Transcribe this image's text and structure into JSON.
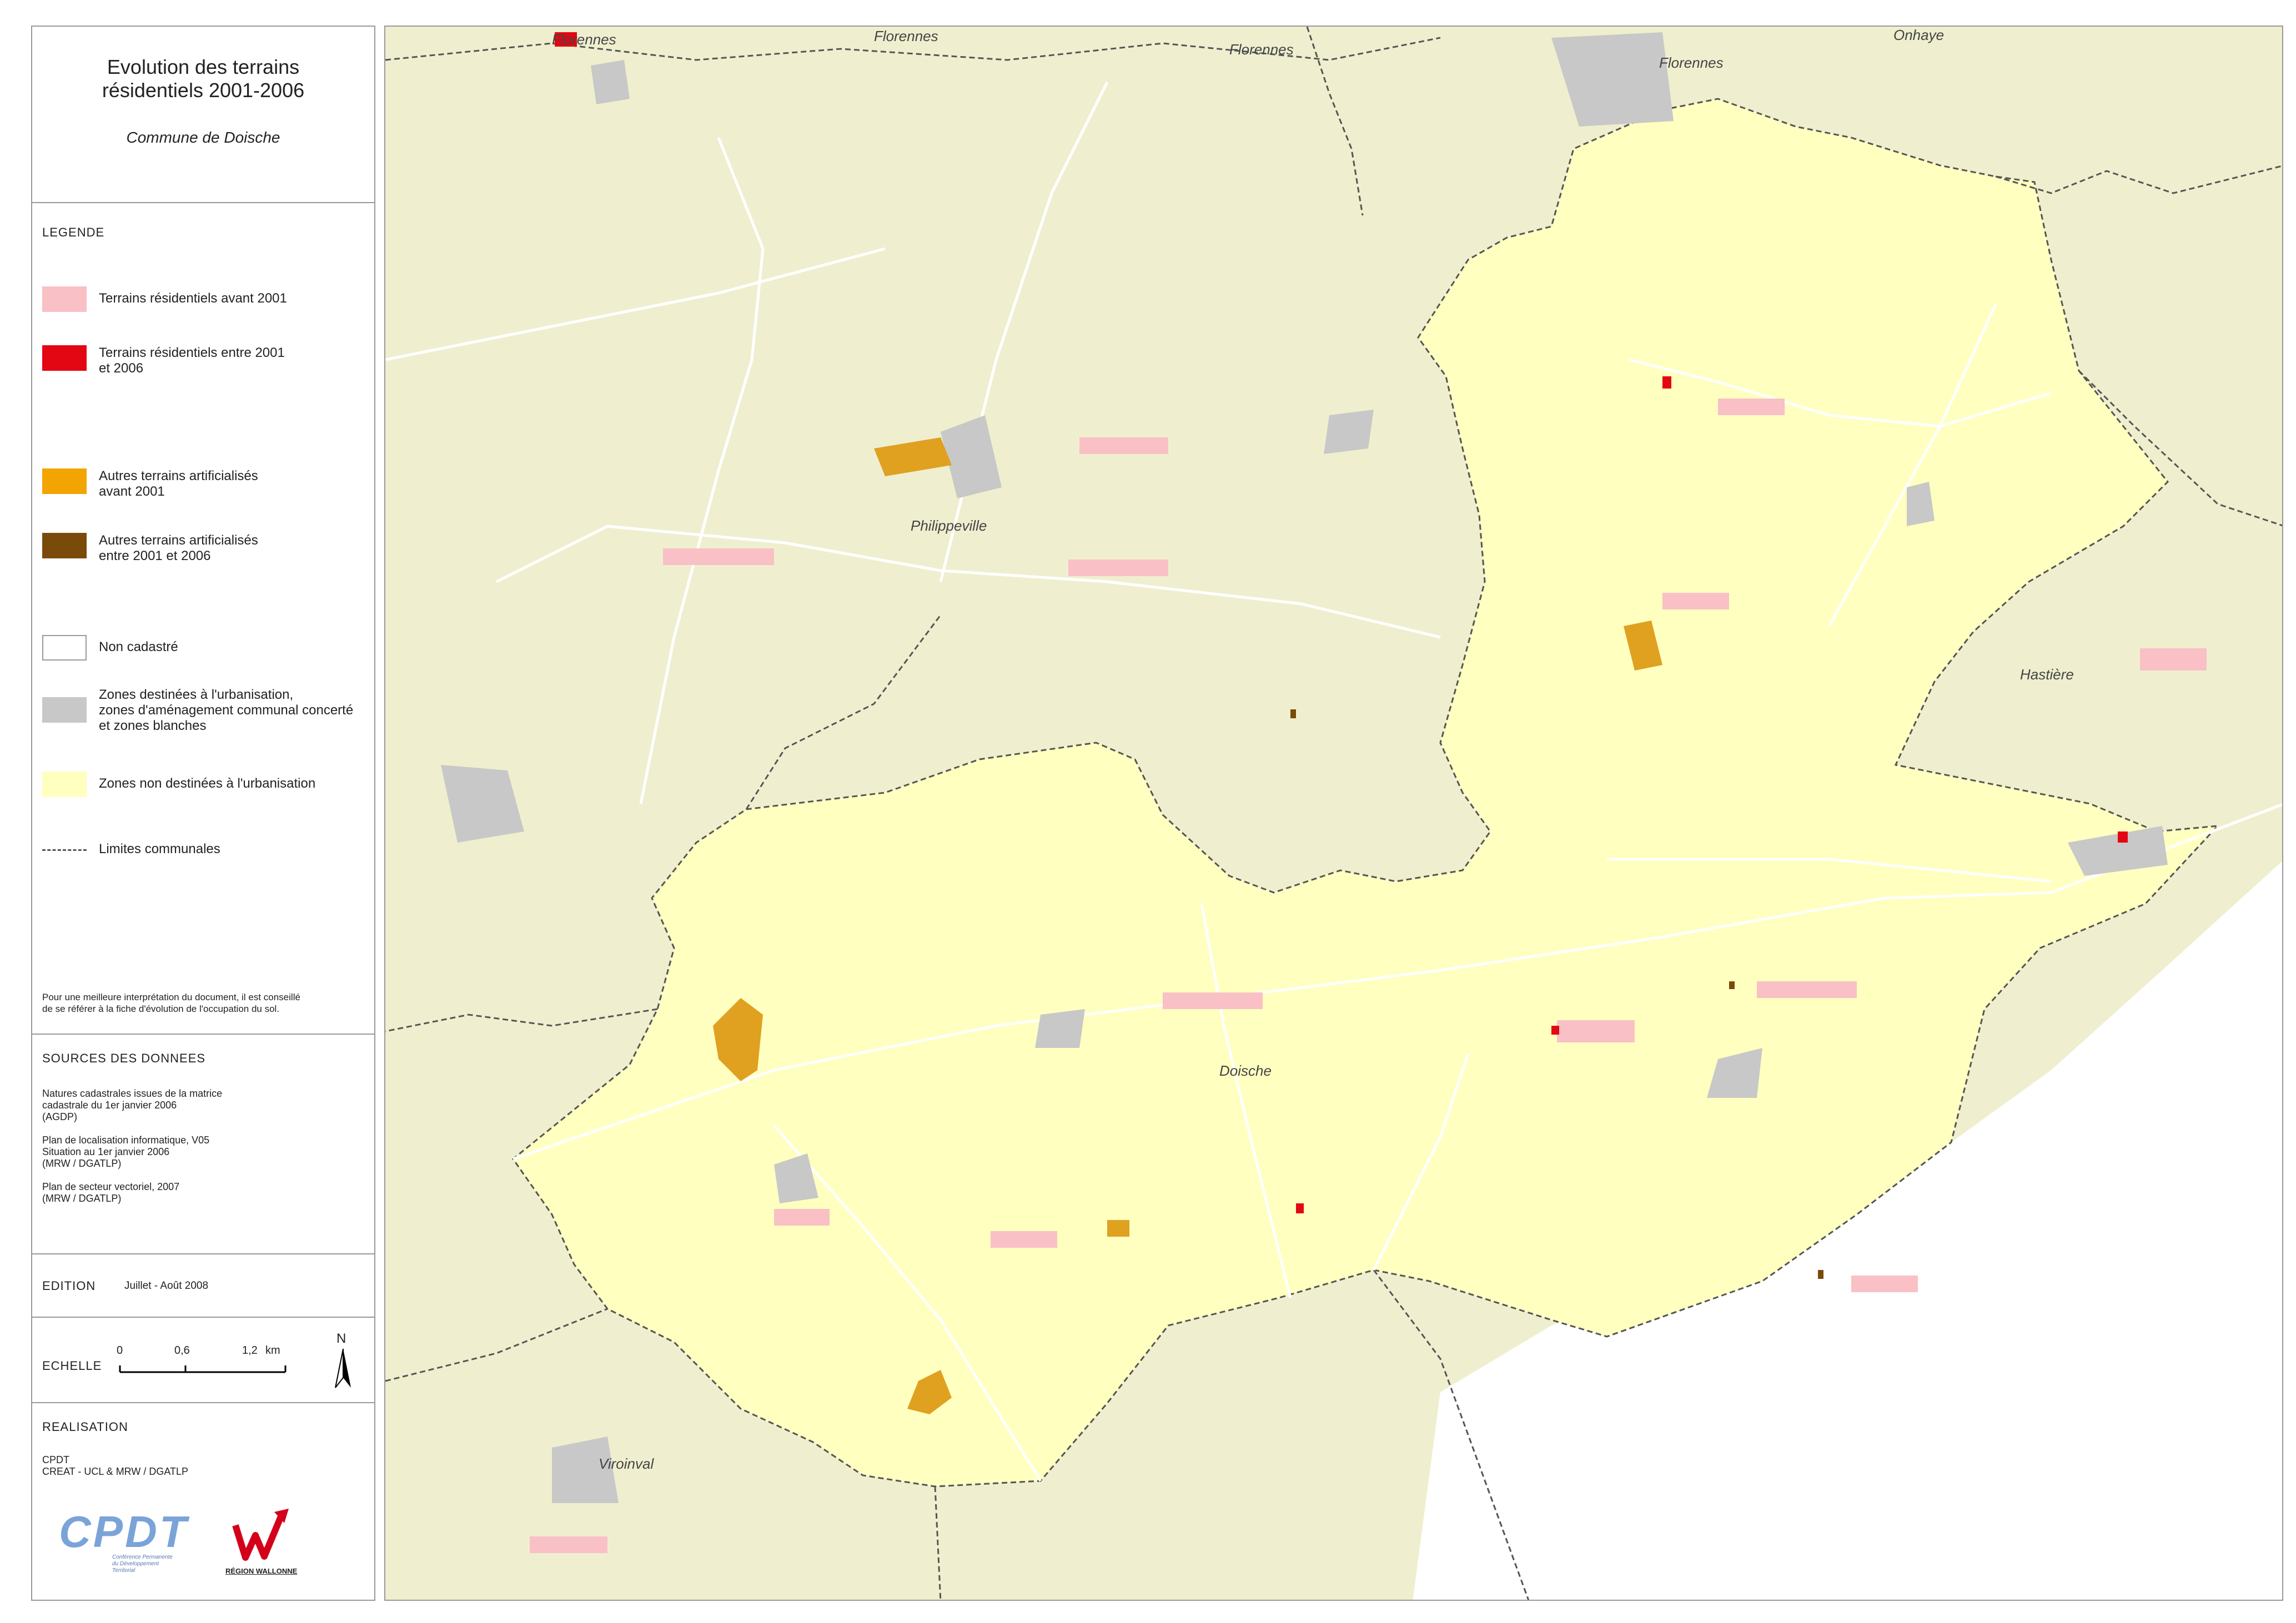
{
  "title": "Evolution des terrains\nrésidentiels 2001-2006",
  "subtitle": "Commune de Doische",
  "legend": {
    "heading": "LEGENDE",
    "items": [
      {
        "label": "Terrains résidentiels avant 2001",
        "color": "#f9c0c6"
      },
      {
        "label": "Terrains résidentiels entre 2001\net 2006",
        "color": "#e30613"
      },
      {
        "label": "Autres terrains artificialisés\navant 2001",
        "color": "#f2a500"
      },
      {
        "label": "Autres terrains artificialisés\nentre 2001 et 2006",
        "color": "#7a4a0a"
      },
      {
        "label": "Non cadastré",
        "color": "#ffffff"
      },
      {
        "label": "Zones destinées à l'urbanisation,\nzones d'aménagement communal concerté\net zones blanches",
        "color": "#c8c8c8"
      },
      {
        "label": "Zones non destinées à l'urbanisation",
        "color": "#ffffc0"
      },
      {
        "label": "Limites communales",
        "color": "#555555"
      }
    ],
    "note": "Pour une meilleure interprétation du document, il est conseillé\nde se référer à la fiche d'évolution de l'occupation du sol."
  },
  "sources": {
    "heading": "SOURCES DES DONNEES",
    "text": "Natures cadastrales issues de la matrice\ncadastrale du 1er janvier 2006\n(AGDP)\n\nPlan de localisation informatique, V05\nSituation au 1er janvier 2006\n(MRW / DGATLP)\n\nPlan de secteur vectoriel, 2007\n(MRW / DGATLP)"
  },
  "edition": {
    "heading": "EDITION",
    "date": "Juillet - Août 2008"
  },
  "scale": {
    "heading": "ECHELLE",
    "ticks": [
      "0",
      "0,6",
      "1,2"
    ],
    "unit": "km",
    "north": "N"
  },
  "realisation": {
    "heading": "REALISATION",
    "text": "CPDT\nCREAT - UCL & MRW / DGATLP",
    "logo1": "CPDT",
    "logo1_sub": "Conférence Permanente\ndu Développement\nTerritorial",
    "logo2_sub": "RÉGION WALLONNE"
  },
  "places": [
    "Florennes",
    "Florennes",
    "Florennes",
    "Florennes",
    "Onhaye",
    "Philippeville",
    "Hastière",
    "Doische",
    "Viroinval"
  ],
  "colors": {
    "outside": "#efefcf",
    "nonurban": "#ffffc0",
    "urban_zone": "#c8c8c8",
    "border": "#555555"
  }
}
